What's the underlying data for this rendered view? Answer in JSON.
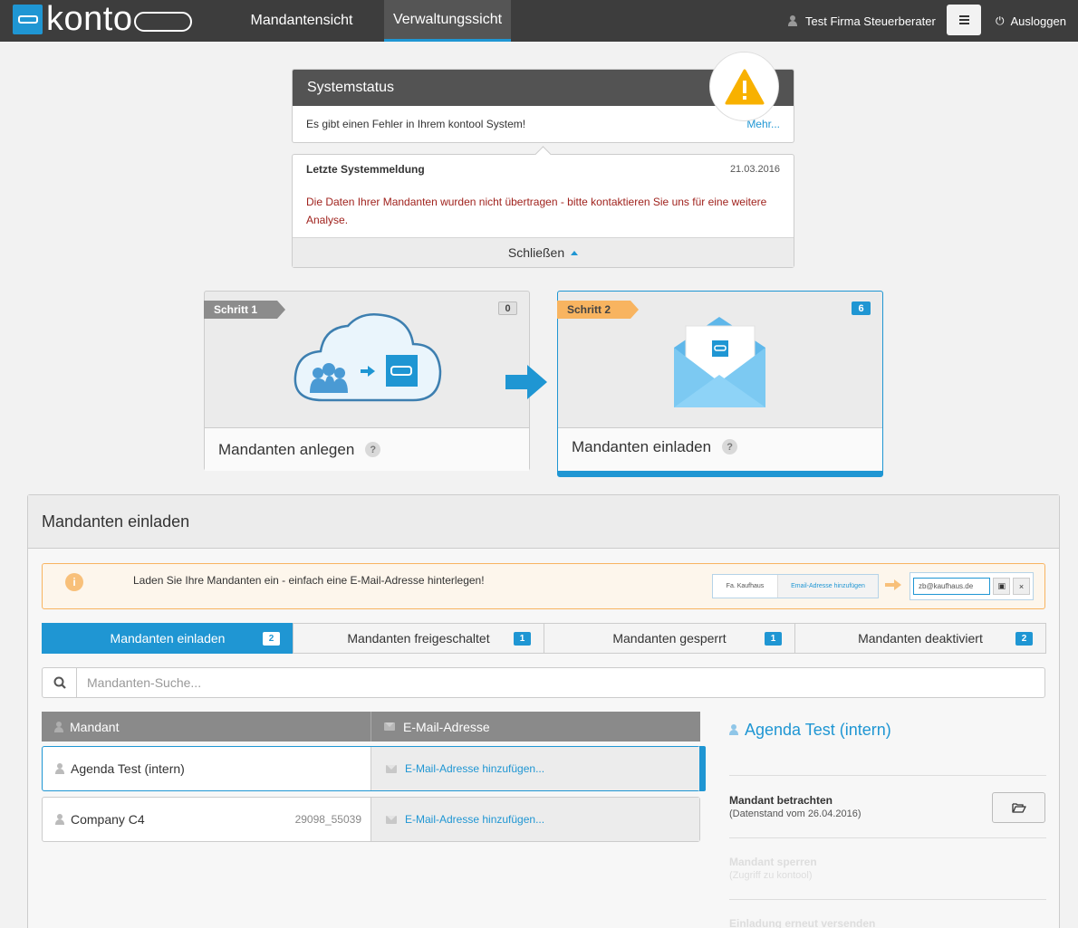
{
  "app": {
    "logo_text": "kontool",
    "nav": [
      "Mandantensicht",
      "Verwaltungssicht"
    ],
    "active_nav": "Verwaltungssicht",
    "user": "Test Firma Steuerberater",
    "logout": "Ausloggen",
    "icons": {
      "user": "user-icon",
      "menu": "hamburger-menu-icon",
      "logout": "power-icon"
    }
  },
  "systemstatus": {
    "title": "Systemstatus",
    "message": "Es gibt einen Fehler in Ihrem kontool System!",
    "more": "Mehr...",
    "icon": "warning-icon"
  },
  "last_message": {
    "title": "Letzte Systemmeldung",
    "date": "21.03.2016",
    "text": "Die Daten Ihrer Mandanten wurden nicht übertragen - bitte kontaktieren Sie uns für eine weitere Analyse.",
    "close": "Schließen"
  },
  "steps": [
    {
      "ribbon": "Schritt 1",
      "count": "0",
      "label": "Mandanten anlegen",
      "help": "?",
      "icon": "cloud-upload-icon"
    },
    {
      "ribbon": "Schritt 2",
      "count": "6",
      "label": "Mandanten einladen",
      "help": "?",
      "icon": "envelope-icon",
      "active": true
    }
  ],
  "panel": {
    "title": "Mandanten einladen",
    "info": "Laden Sie Ihre Mandanten ein - einfach eine E-Mail-Adresse hinterlegen!",
    "info_icon": "i",
    "example": {
      "name": "Fa. Kaufhaus",
      "link": "Email-Adresse hinzufügen",
      "email": "zb@kaufhaus.de",
      "close": "×"
    },
    "tabs": [
      {
        "label": "Mandanten einladen",
        "count": "2",
        "active": true
      },
      {
        "label": "Mandanten freigeschaltet",
        "count": "1"
      },
      {
        "label": "Mandanten gesperrt",
        "count": "1"
      },
      {
        "label": "Mandanten deaktiviert",
        "count": "2"
      }
    ],
    "search_placeholder": "Mandanten-Suche...",
    "table": {
      "headers": [
        "Mandant",
        "E-Mail-Adresse"
      ],
      "rows": [
        {
          "name": "Agenda Test (intern)",
          "id": "",
          "email": "E-Mail-Adresse hinzufügen...",
          "selected": true
        },
        {
          "name": "Company C4",
          "id": "29098_55039",
          "email": "E-Mail-Adresse hinzufügen..."
        }
      ]
    },
    "detail": {
      "title": "Agenda Test (intern)",
      "items": [
        {
          "title": "Mandant betrachten",
          "sub": "(Datenstand vom 26.04.2016)",
          "icon": "folder-open-icon"
        },
        {
          "title": "Mandant sperren",
          "sub": "(Zugriff zu kontool)"
        },
        {
          "title": "Einladung erneut versenden",
          "sub": ""
        }
      ]
    }
  },
  "colors": {
    "accent": "#1f96d3",
    "warning": "#f8b460",
    "error": "#a0231e",
    "nav_bg": "#3d3d3d"
  }
}
